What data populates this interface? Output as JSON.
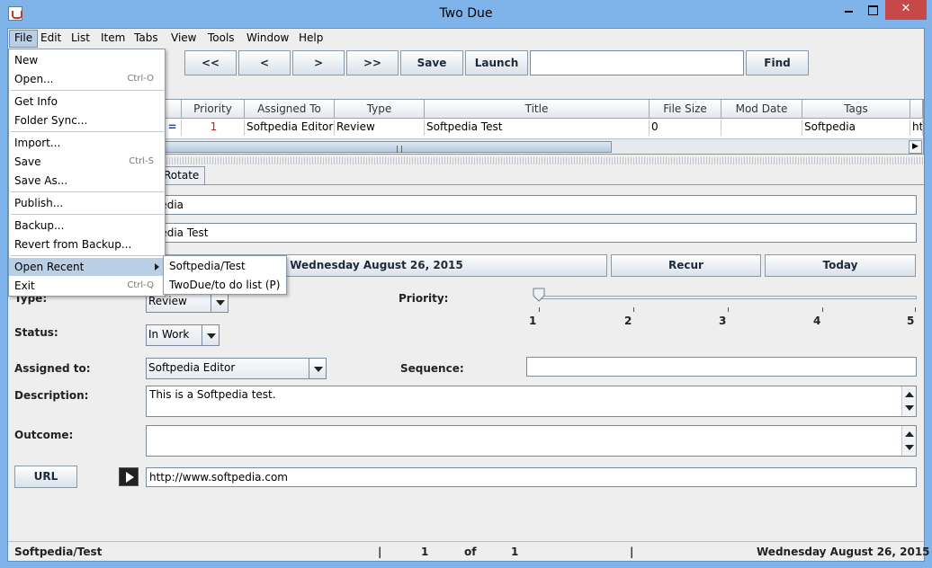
{
  "window": {
    "title": "Two Due"
  },
  "menubar": [
    "File",
    "Edit",
    "List",
    "Item",
    "Tabs",
    "View",
    "Tools",
    "Window",
    "Help"
  ],
  "toolbar": {
    "first": "<<",
    "prev": "<",
    "next": ">",
    "last": ">>",
    "save": "Save",
    "launch": "Launch",
    "find": "Find",
    "find_value": ""
  },
  "table": {
    "headers": [
      "Priority",
      "Assigned To",
      "Type",
      "Title",
      "File Size",
      "Mod Date",
      "Tags"
    ],
    "row": {
      "status_icon": "=",
      "priority": "1",
      "assigned_to": "Softpedia Editor",
      "type": "Review",
      "title": "Softpedia Test",
      "file_size": "0",
      "mod_date": "",
      "tags": "Softpedia",
      "overflow": "htt"
    }
  },
  "tabs": {
    "rotate": "Rotate"
  },
  "fields": {
    "field1": "tpedia",
    "field2": "tpedia Test",
    "date_button": "Wednesday  August 26, 2015",
    "recur": "Recur",
    "today": "Today"
  },
  "labels": {
    "type": "Type:",
    "priority": "Priority:",
    "status": "Status:",
    "assigned_to": "Assigned to:",
    "sequence": "Sequence:",
    "description": "Description:",
    "outcome": "Outcome:",
    "url": "URL"
  },
  "values": {
    "type": "Review",
    "status": "In Work",
    "assigned_to": "Softpedia Editor",
    "sequence": "",
    "description": "This is a Softpedia test.",
    "outcome": "",
    "url": "http://www.softpedia.com",
    "priority_ticks": [
      "1",
      "2",
      "3",
      "4",
      "5"
    ],
    "priority_value": 1
  },
  "statusbar": {
    "list": "Softpedia/Test",
    "sep1": "|",
    "current": "1",
    "of": "of",
    "total": "1",
    "sep2": "|",
    "date": "Wednesday August 26, 2015"
  },
  "file_menu": {
    "new": "New",
    "open": "Open...",
    "open_sc": "Ctrl-O",
    "get_info": "Get Info",
    "folder_sync": "Folder Sync...",
    "import": "Import...",
    "save": "Save",
    "save_sc": "Ctrl-S",
    "save_as": "Save As...",
    "publish": "Publish...",
    "backup": "Backup...",
    "revert": "Revert from Backup...",
    "open_recent": "Open Recent",
    "exit": "Exit",
    "exit_sc": "Ctrl-Q"
  },
  "recent_menu": [
    "Softpedia/Test",
    "TwoDue/to do list (P)"
  ]
}
